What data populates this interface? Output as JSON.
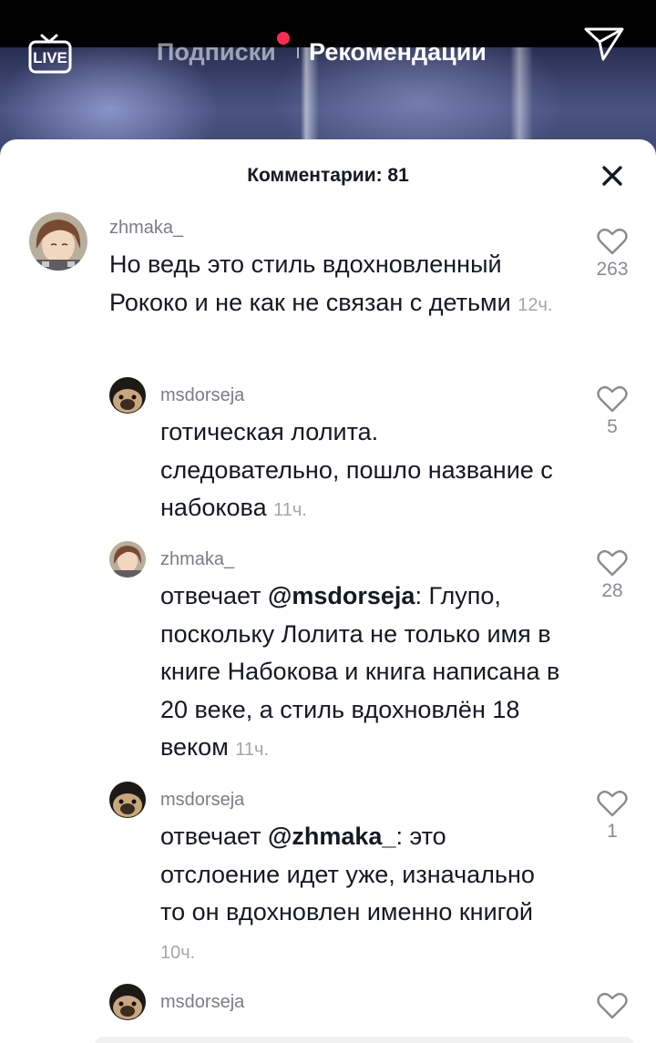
{
  "top_bar": {
    "live_label": "LIVE",
    "tabs": [
      {
        "label": "Подписки",
        "has_notification_dot": true
      },
      {
        "label": "Рекомендации",
        "active": true
      }
    ],
    "share_icon": "send-arrow-icon"
  },
  "colors": {
    "accent_dot": "#fe2c55",
    "text_primary": "#161823",
    "text_secondary": "#7c7c85"
  },
  "comments_sheet": {
    "title": "Комментарии: 81",
    "close_icon": "close-icon",
    "comments": [
      {
        "username": "zhmaka_",
        "text": "Но ведь это стиль вдохновленный Рококо и не как не связан с детьми",
        "time": "12ч.",
        "likes": "263",
        "is_reply": false
      },
      {
        "username": "msdorseja",
        "text": "готическая лолита. следовательно, пошло название с набокова",
        "time": "11ч.",
        "likes": "5",
        "is_reply": true
      },
      {
        "username": "zhmaka_",
        "reply_prefix": "отвечает ",
        "mention": "@msdorseja",
        "text": ": Глупо, поскольку Лолита не только имя в книге Набокова и книга написана в 20 веке, а стиль вдохновлён 18 веком",
        "time": "11ч.",
        "likes": "28",
        "is_reply": true
      },
      {
        "username": "msdorseja",
        "reply_prefix": "отвечает ",
        "mention": "@zhmaka_",
        "text": ": это отслоение идет уже, изначально то он вдохновлен именно книгой",
        "time": "10ч.",
        "likes": "1",
        "is_reply": true
      },
      {
        "username": "msdorseja",
        "text": "",
        "time": "",
        "likes": "",
        "is_reply": true
      }
    ]
  }
}
